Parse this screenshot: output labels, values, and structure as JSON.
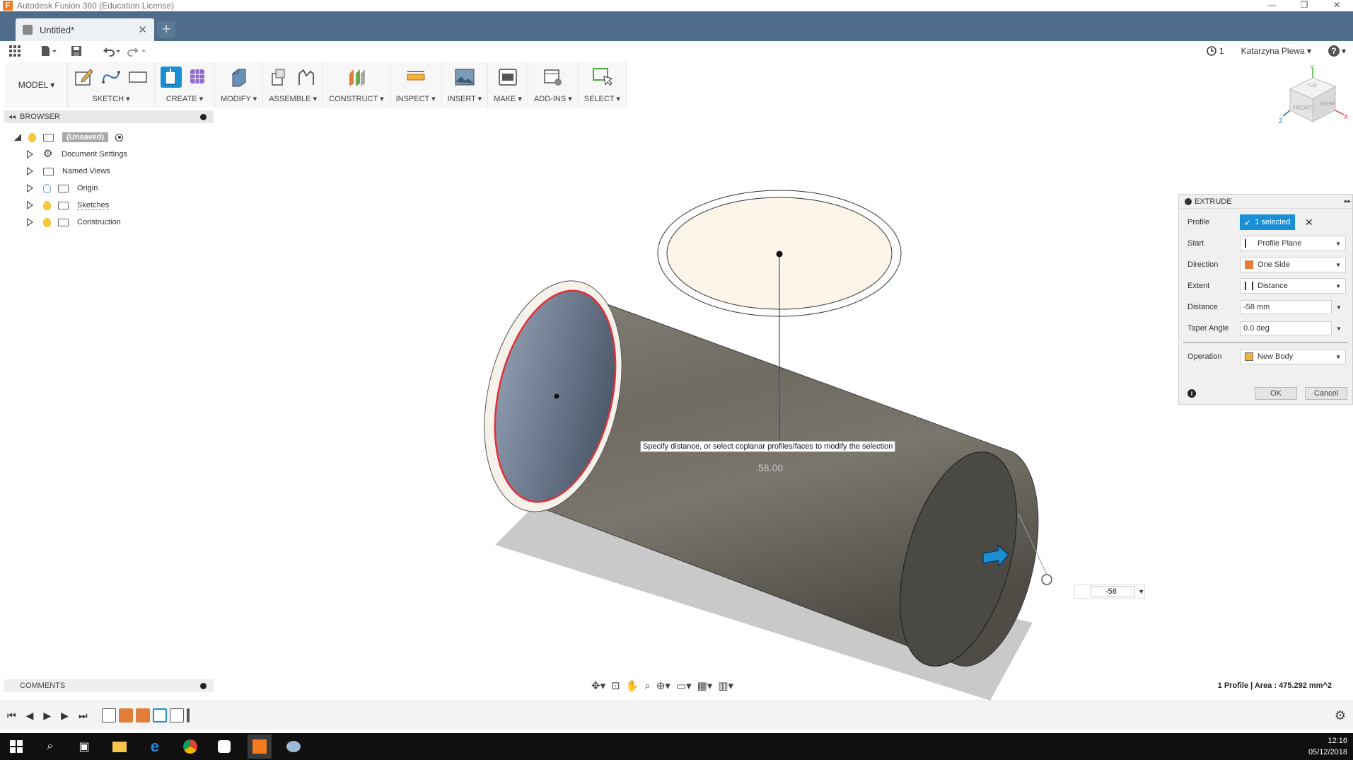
{
  "window": {
    "title": "Autodesk Fusion 360 (Education License)",
    "controls": [
      "—",
      "❐",
      "✕"
    ]
  },
  "tabs": [
    {
      "label": "Untitled*"
    }
  ],
  "quickbar": {
    "job_count": "1",
    "user": "Katarzyna Plewa ▾",
    "help": "?"
  },
  "ribbon": {
    "workspace": "MODEL ▾",
    "groups": [
      "SKETCH ▾",
      "CREATE ▾",
      "MODIFY ▾",
      "ASSEMBLE ▾",
      "CONSTRUCT ▾",
      "INSPECT ▾",
      "INSERT ▾",
      "MAKE ▾",
      "ADD-INS ▾",
      "SELECT ▾"
    ]
  },
  "browser": {
    "title": "BROWSER",
    "root": "(Unsaved)",
    "items": [
      {
        "label": "Document Settings",
        "icon": "gear-icon"
      },
      {
        "label": "Named Views",
        "icon": "folder-icon"
      },
      {
        "label": "Origin",
        "icon": "folder-icon"
      },
      {
        "label": "Sketches",
        "icon": "folder-icon"
      },
      {
        "label": "Construction",
        "icon": "folder-icon"
      }
    ]
  },
  "viewport": {
    "tooltip": "Specify distance, or select coplanar profiles/faces to modify the selection",
    "dimension": "58.00",
    "distance_input": "-58"
  },
  "viewcube": {
    "top": "TOP",
    "front": "FRONT",
    "right": "RIGHT",
    "axis_y": "Y",
    "axis_x": "X",
    "axis_z": "Z"
  },
  "extrude": {
    "title": "EXTRUDE",
    "profile_label": "Profile",
    "profile_value": "1 selected",
    "start_label": "Start",
    "start_value": "Profile Plane",
    "direction_label": "Direction",
    "direction_value": "One Side",
    "extent_label": "Extent",
    "extent_value": "Distance",
    "distance_label": "Distance",
    "distance_value": "-58 mm",
    "taper_label": "Taper Angle",
    "taper_value": "0.0 deg",
    "operation_label": "Operation",
    "operation_value": "New Body",
    "ok": "OK",
    "cancel": "Cancel"
  },
  "comments": {
    "title": "COMMENTS"
  },
  "status": {
    "text": "1 Profile | Area : 475.292 mm^2"
  },
  "taskbar": {
    "time": "12:16",
    "date": "05/12/2018"
  },
  "colors": {
    "tabbar": "#4f6d8a",
    "accent": "#1a8fd6",
    "selection_red": "#e0303a",
    "body": "#6e6a62"
  }
}
